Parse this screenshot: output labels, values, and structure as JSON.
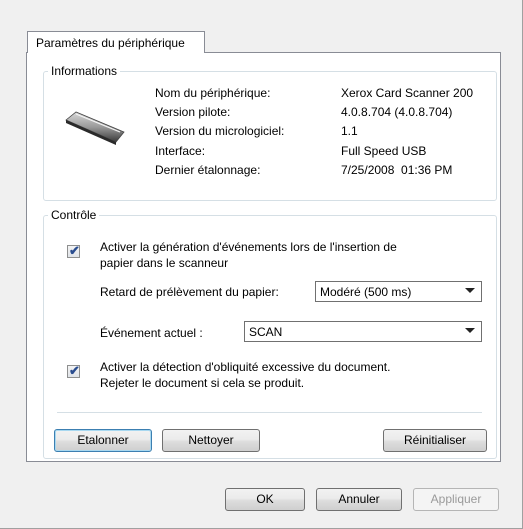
{
  "tab": {
    "label": "Paramètres du périphérique"
  },
  "info": {
    "title": "Informations",
    "rows": [
      {
        "label": "Nom du périphérique:",
        "value": "Xerox Card Scanner 200"
      },
      {
        "label": "Version pilote:",
        "value": "4.0.8.704 (4.0.8.704)"
      },
      {
        "label": "Version du micrologiciel:",
        "value": "1.1"
      },
      {
        "label": "Interface:",
        "value": "Full Speed USB"
      },
      {
        "label": "Dernier étalonnage:",
        "value": "7/25/2008  01:36 PM"
      }
    ]
  },
  "control": {
    "title": "Contrôle",
    "check1_line1": "Activer la génération d'événements lors de l'insertion de",
    "check1_line2": "papier dans le scanneur",
    "check1_checked": true,
    "delay_label": "Retard de prélèvement du papier:",
    "delay_value": "Modéré (500 ms)",
    "event_label": "Événement actuel :",
    "event_value": "SCAN",
    "check2_line1": "Activer la détection d'obliquité excessive du document.",
    "check2_line2": "Rejeter le document si cela se produit.",
    "check2_checked": true,
    "calibrate_label": "Etalonner",
    "clean_label": "Nettoyer",
    "reset_label": "Réinitialiser"
  },
  "footer": {
    "ok_label": "OK",
    "cancel_label": "Annuler",
    "apply_label": "Appliquer"
  },
  "icons": {
    "checkmark": "✔",
    "device": "scanner-icon"
  }
}
